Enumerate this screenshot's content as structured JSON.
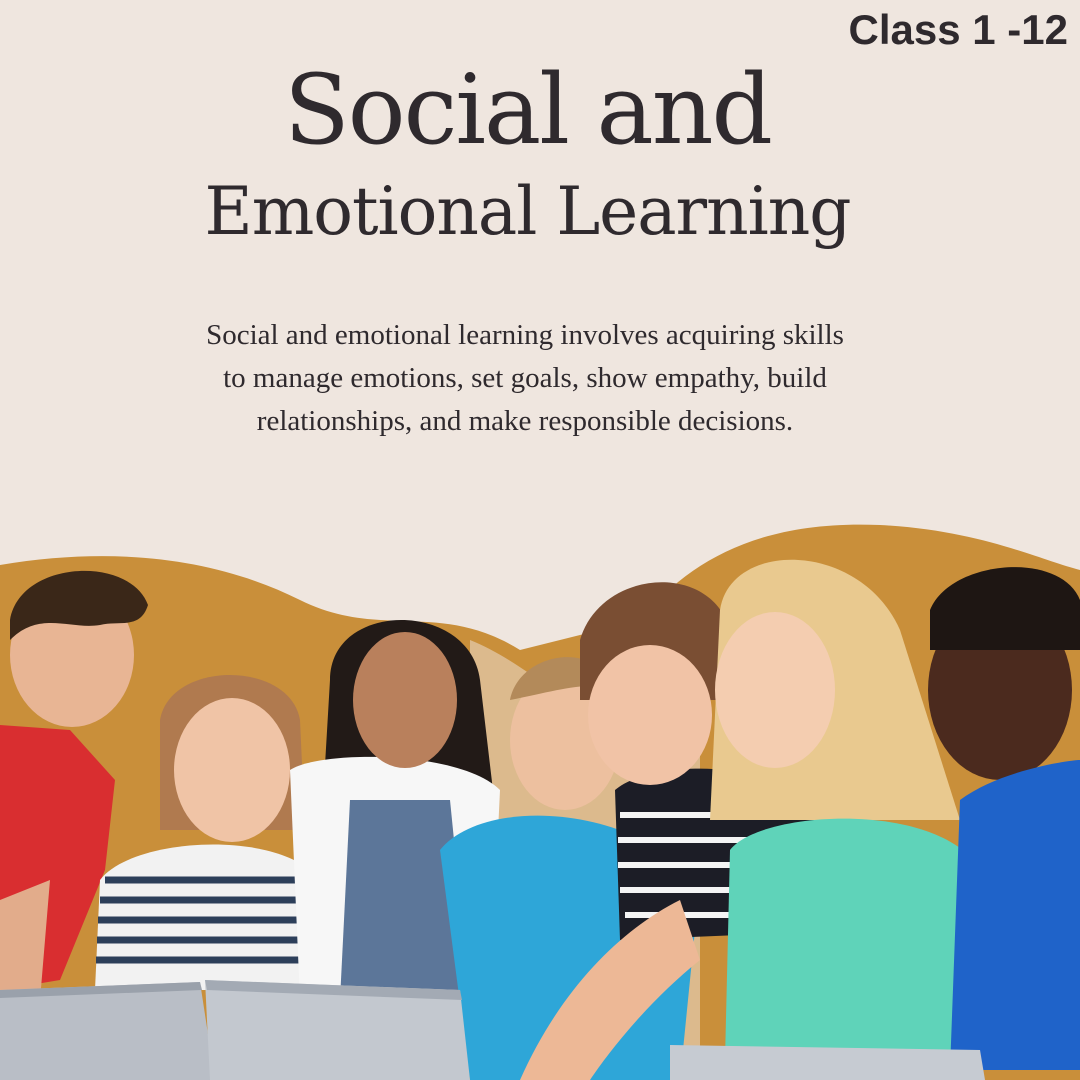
{
  "header": {
    "class_tag": "Class 1 -12",
    "title_line1": "Social and",
    "title_line2": "Emotional Learning"
  },
  "description": "Social and emotional learning involves acquiring skills to manage emotions, set goals, show empathy, build relationships, and make responsible decisions.",
  "colors": {
    "background": "#EFE6DF",
    "accent_blob": "#C98F3A",
    "text": "#2F2A2E"
  },
  "image": {
    "subject": "group-of-students-with-teacher-at-laptops-icon"
  }
}
